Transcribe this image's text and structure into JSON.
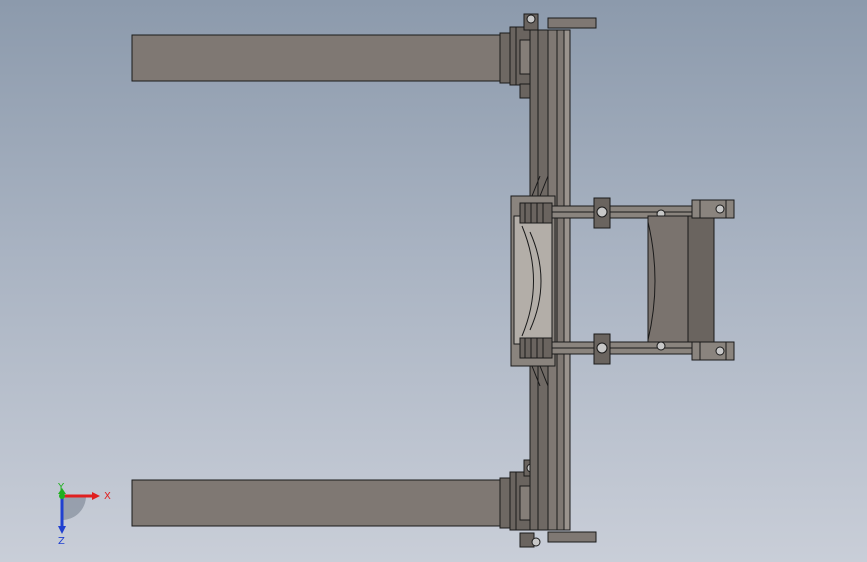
{
  "triad": {
    "x_label": "X",
    "y_label": "Y",
    "z_label": "Z",
    "x_color": "#e02020",
    "y_color": "#20b020",
    "z_color": "#2040d0"
  },
  "palette": {
    "part_fill": "#7f7873",
    "part_dark": "#5d5753",
    "part_light": "#9a938d",
    "edge": "#1a1a1a",
    "pin_fill": "#c8c8c8"
  }
}
